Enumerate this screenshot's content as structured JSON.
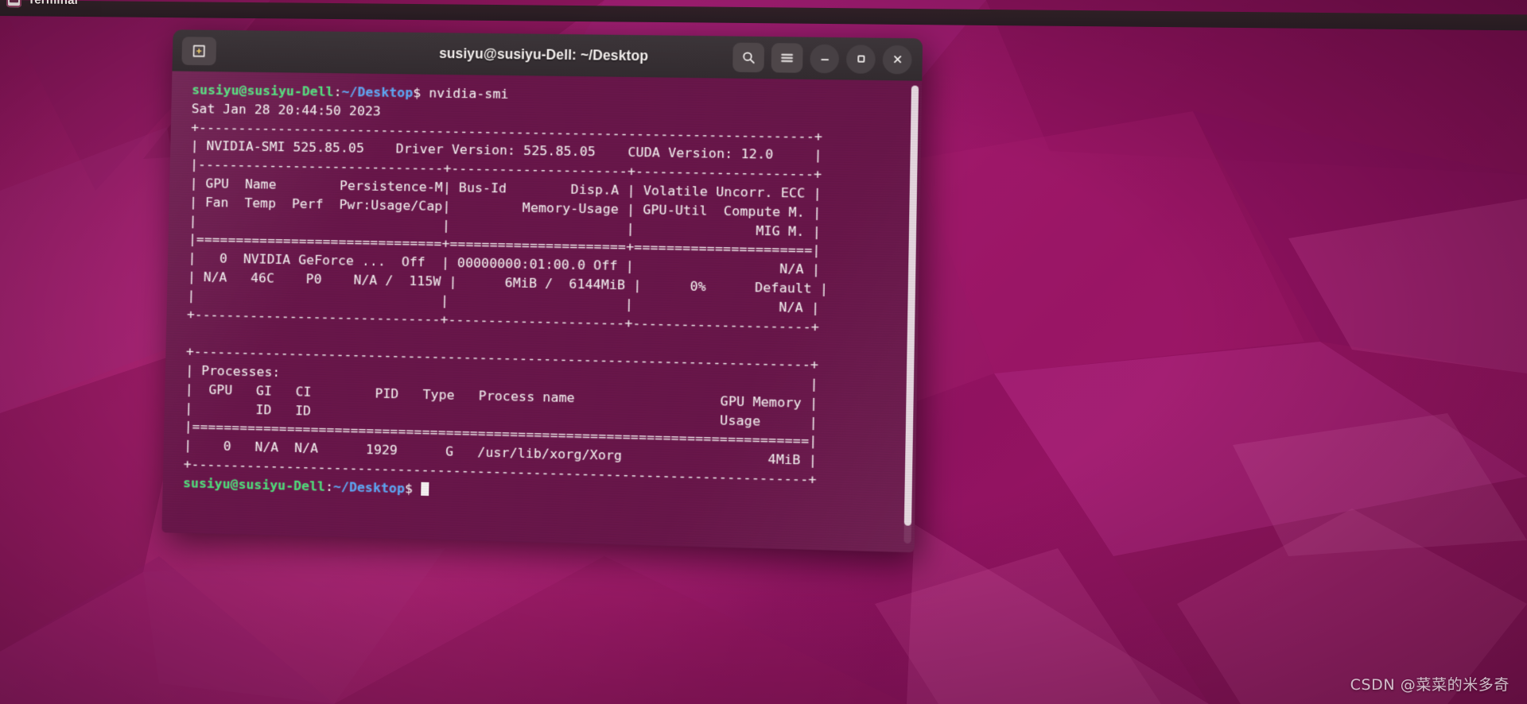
{
  "desktop": {
    "taskbar": {
      "app_label": "Terminal",
      "app_icon": "terminal-icon"
    },
    "watermark": "CSDN @菜菜的米多奇",
    "wallpaper_colors": [
      "#9c1566",
      "#b01f79",
      "#8e1260",
      "#a81a70",
      "#d6348c"
    ]
  },
  "window": {
    "title": "susiyu@susiyu-Dell: ~/Desktop",
    "new_tab_label": "+",
    "buttons": {
      "search": "search-icon",
      "menu": "hamburger-menu-icon",
      "minimize": "minimize-icon",
      "maximize": "maximize-icon",
      "close": "close-icon"
    },
    "titlebar_color": "#3c3539",
    "terminal_bg": "#69164a"
  },
  "terminal": {
    "prompt": {
      "user_host": "susiyu@susiyu-Dell",
      "colon": ":",
      "path": "~/Desktop",
      "dollar": "$"
    },
    "command": " nvidia-smi",
    "date_line": "Sat Jan 28 20:44:50 2023",
    "smi": {
      "rule_top": "+-----------------------------------------------------------------------------+",
      "version_line": "| NVIDIA-SMI 525.85.05    Driver Version: 525.85.05    CUDA Version: 12.0     |",
      "rule_2": "|-------------------------------+----------------------+----------------------+",
      "header_1": "| GPU  Name        Persistence-M| Bus-Id        Disp.A | Volatile Uncorr. ECC |",
      "header_2": "| Fan  Temp  Perf  Pwr:Usage/Cap|         Memory-Usage | GPU-Util  Compute M. |",
      "header_3": "|                               |                      |               MIG M. |",
      "rule_3": "|===============================+======================+======================|",
      "gpu_row_1": "|   0  NVIDIA GeForce ...  Off  | 00000000:01:00.0 Off |                  N/A |",
      "gpu_row_2": "| N/A   46C    P0    N/A /  115W |      6MiB /  6144MiB |      0%      Default |",
      "gpu_row_3": "|                               |                      |                  N/A |",
      "rule_4": "+-------------------------------+----------------------+----------------------+",
      "blank": "                                                                               ",
      "proc_rule_top": "+-----------------------------------------------------------------------------+",
      "proc_header_1": "| Processes:                                                                  |",
      "proc_header_2": "|  GPU   GI   CI        PID   Type   Process name                  GPU Memory |",
      "proc_header_3": "|        ID   ID                                                   Usage      |",
      "proc_rule_2": "|=============================================================================|",
      "proc_row_1": "|    0   N/A  N/A      1929      G   /usr/lib/xorg/Xorg                  4MiB |",
      "proc_rule_bottom": "+-----------------------------------------------------------------------------+"
    },
    "values": {
      "nvidia_smi_version": "525.85.05",
      "driver_version": "525.85.05",
      "cuda_version": "12.0",
      "gpu_index": "0",
      "gpu_name": "NVIDIA GeForce ...",
      "persistence_m": "Off",
      "bus_id": "00000000:01:00.0",
      "disp_a": "Off",
      "uncorr_ecc": "N/A",
      "fan": "N/A",
      "temp": "46C",
      "perf": "P0",
      "pwr_usage_cap": "N/A / 115W",
      "memory_used": "6MiB",
      "memory_total": "6144MiB",
      "gpu_util": "0%",
      "compute_m": "Default",
      "mig_m": "N/A",
      "process": {
        "gpu": "0",
        "gi_id": "N/A",
        "ci_id": "N/A",
        "pid": "1929",
        "type": "G",
        "name": "/usr/lib/xorg/Xorg",
        "gpu_memory_usage": "4MiB"
      }
    }
  }
}
